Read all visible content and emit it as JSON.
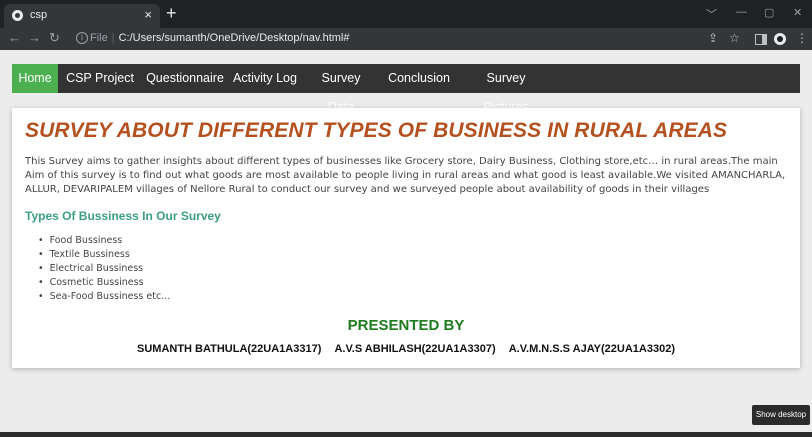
{
  "browser": {
    "tab_title": "csp",
    "tab_close": "×",
    "new_tab": "+",
    "url_prefix": "File",
    "url": "C:/Users/sumanth/OneDrive/Desktop/nav.html#",
    "window_controls": [
      "﹀",
      "—",
      "▢",
      "✕"
    ]
  },
  "nav": {
    "items": [
      "Home",
      "CSP Project",
      "Questionnaire",
      "Activity Log",
      "Survey Data",
      "Conclusion",
      "Survey Pictures"
    ],
    "active": "Home",
    "active_color": "#4CAF50"
  },
  "main": {
    "heading": "SURVEY ABOUT DIFFERENT TYPES OF BUSINESS IN RURAL AREAS",
    "description": "This Survey aims to gather insights about different types of businesses like Grocery store, Dairy Business, Clothing store,etc… in rural areas.The main Aim of this survey is to find out what goods are most available to people living in rural areas and what good is least available.We visited AMANCHARLA, ALLUR, DEVARIPALEM villages of Nellore Rural to conduct our survey and we surveyed people about availability of goods in their villages",
    "subheading": "Types Of Bussiness In Our Survey",
    "business_types": [
      "Food Bussiness",
      "Textile Bussiness",
      "Electrical Bussiness",
      "Cosmetic Bussiness",
      "Sea-Food Bussiness etc..."
    ],
    "presented_by_label": "PRESENTED BY",
    "presenters": [
      "SUMANTH BATHULA(22UA1A3317)",
      "A.V.S ABHILASH(22UA1A3307)",
      "A.V.M.N.S.S AJAY(22UA1A3302)"
    ]
  },
  "taskbar": {
    "show_desktop": "Show desktop"
  },
  "colors": {
    "heading": "#b5501f",
    "subheading": "#3c9e85",
    "presented_by": "#1e7b1e",
    "nav_bg": "#333333"
  }
}
